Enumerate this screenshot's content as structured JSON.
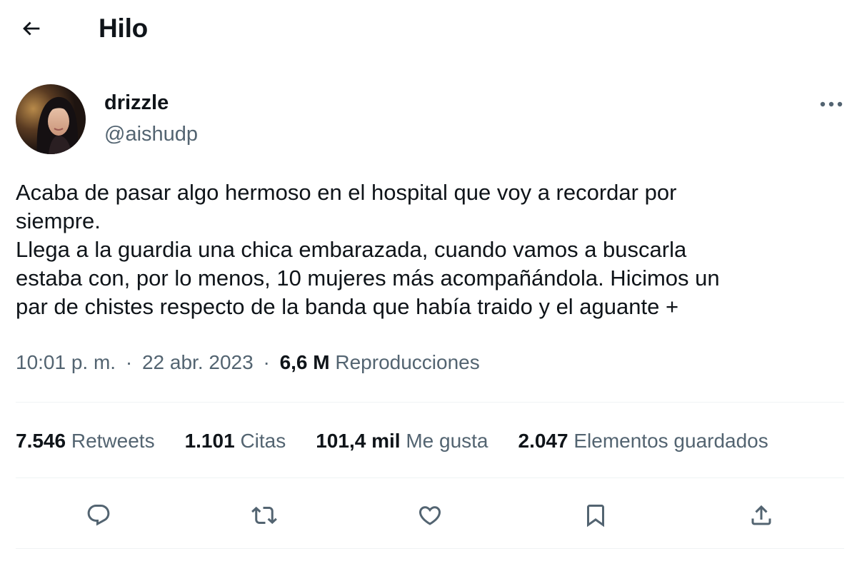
{
  "header": {
    "title": "Hilo"
  },
  "author": {
    "display_name": "drizzle",
    "handle": "@aishudp"
  },
  "tweet": {
    "lines": [
      "Acaba de pasar algo hermoso en el hospital que voy a recordar por",
      "siempre.",
      "Llega a la guardia una chica embarazada, cuando vamos a buscarla",
      "estaba con, por lo menos, 10 mujeres más acompañándola. Hicimos un",
      "par de chistes respecto de la banda que había traido y el aguante +"
    ]
  },
  "meta": {
    "time": "10:01 p. m.",
    "separator": "·",
    "date": "22 abr. 2023",
    "views_count": "6,6 M",
    "views_label": "Reproducciones"
  },
  "stats": {
    "retweets": {
      "count": "7.546",
      "label": "Retweets"
    },
    "quotes": {
      "count": "1.101",
      "label": "Citas"
    },
    "likes": {
      "count": "101,4 mil",
      "label": "Me gusta"
    },
    "bookmarks": {
      "count": "2.047",
      "label": "Elementos guardados"
    }
  },
  "icons": {
    "back": "arrow-left-icon",
    "more": "more-horizontal-icon",
    "reply": "reply-icon",
    "retweet": "retweet-icon",
    "like": "heart-icon",
    "bookmark": "bookmark-icon",
    "share": "share-icon"
  },
  "colors": {
    "text_primary": "#0f1419",
    "text_secondary": "#536471",
    "divider": "#eff3f4"
  }
}
